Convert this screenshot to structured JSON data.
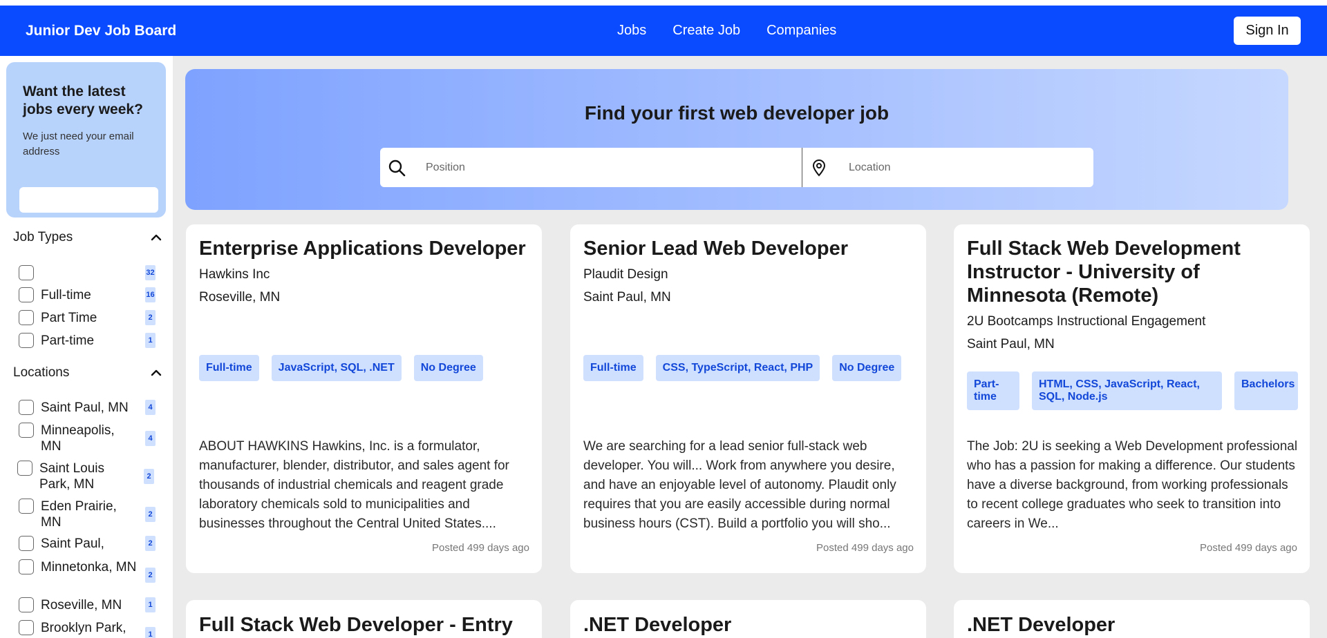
{
  "navbar": {
    "brand": "Junior Dev Job Board",
    "links": [
      "Jobs",
      "Create Job",
      "Companies"
    ],
    "sign_in": "Sign In"
  },
  "newsletter": {
    "heading": "Want the latest jobs every week?",
    "subtext": "We just need your email address",
    "email_value": ""
  },
  "filters": {
    "job_types": {
      "label": "Job Types",
      "options": [
        {
          "label": "",
          "count": "32"
        },
        {
          "label": "Full-time",
          "count": "16"
        },
        {
          "label": "Part Time",
          "count": "2"
        },
        {
          "label": "Part-time",
          "count": "1"
        }
      ]
    },
    "locations": {
      "label": "Locations",
      "options": [
        {
          "label": "Saint Paul, MN",
          "count": "4"
        },
        {
          "label": "Minneapolis, MN",
          "count": "4"
        },
        {
          "label": "Saint Louis Park, MN",
          "count": "2"
        },
        {
          "label": "Eden Prairie, MN",
          "count": "2"
        },
        {
          "label": "Saint Paul,",
          "count": "2"
        },
        {
          "label": "Minnetonka, MN",
          "count": "2"
        },
        {
          "label": "Roseville, MN",
          "count": "1"
        },
        {
          "label": "Brooklyn Park,",
          "count": "1"
        }
      ]
    }
  },
  "hero": {
    "heading": "Find your first web developer job",
    "position_placeholder": "Position",
    "location_placeholder": "Location"
  },
  "jobs": [
    {
      "title": "Enterprise Applications Developer",
      "company": "Hawkins Inc",
      "location": "Roseville, MN",
      "tags": [
        "Full-time",
        "JavaScript, SQL, .NET",
        "No Degree"
      ],
      "description": "ABOUT HAWKINS Hawkins, Inc. is a formulator, manufacturer, blender, distributor, and sales agent for thousands of industrial chemicals and reagent grade laboratory chemicals sold to municipalities and businesses throughout the Central United States....",
      "posted": "Posted 499 days ago"
    },
    {
      "title": "Senior Lead Web Developer",
      "company": "Plaudit Design",
      "location": "Saint Paul, MN",
      "tags": [
        "Full-time",
        "CSS, TypeScript, React, PHP",
        "No Degree"
      ],
      "description": "We are searching for a lead senior full-stack web developer. You will... Work from anywhere you desire, and have an enjoyable level of autonomy. Plaudit only requires that you are easily accessible during normal business hours (CST). Build a portfolio you will sho...",
      "posted": "Posted 499 days ago"
    },
    {
      "title": "Full Stack Web Development Instructor - University of Minnesota (Remote)",
      "company": "2U Bootcamps Instructional Engagement",
      "location": "Saint Paul, MN",
      "tags": [
        "Part-time",
        "HTML, CSS, JavaScript, React, SQL, Node.js",
        "Bachelors"
      ],
      "description": "The Job: 2U is seeking a Web Development professional who has a passion for making a difference. Our students have a diverse background, from working professionals to recent college graduates who seek to transition into careers in We...",
      "posted": "Posted 499 days ago"
    },
    {
      "title": "Full Stack Web Developer - Entry"
    },
    {
      "title": ".NET Developer"
    },
    {
      "title": ".NET Developer"
    }
  ]
}
